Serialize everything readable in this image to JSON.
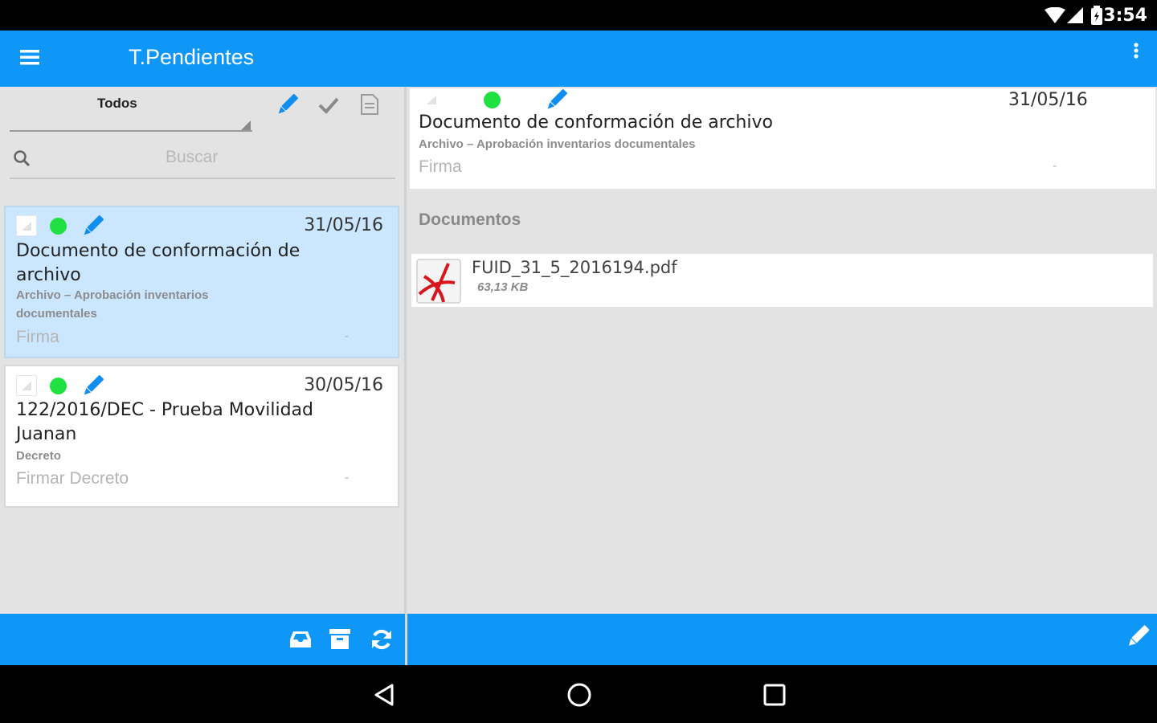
{
  "status_bar": {
    "time": "3:54",
    "icons": [
      "wifi-icon",
      "signal-icon",
      "battery-icon"
    ]
  },
  "app_bar": {
    "title": "T.Pendientes",
    "menu_icon": "hamburger-menu-icon",
    "overflow_icon": "overflow-menu-icon"
  },
  "filter": {
    "selected": "Todos",
    "actions": [
      "edit-icon",
      "check-icon",
      "document-icon"
    ]
  },
  "search": {
    "placeholder": "Buscar"
  },
  "tasks": [
    {
      "date": "31/05/16",
      "title": "Documento de conformación de archivo",
      "subtitle": "Archivo – Aprobación inventarios documentales",
      "action": "Firma",
      "dash": "-",
      "status_color": "#21e041",
      "selected": true
    },
    {
      "date": "30/05/16",
      "title": "122/2016/DEC - Prueba Movilidad Juanan",
      "subtitle": "Decreto",
      "action": "Firmar Decreto",
      "dash": "-",
      "status_color": "#21e041",
      "selected": false
    }
  ],
  "detail": {
    "date": "31/05/16",
    "title": "Documento de conformación de archivo",
    "subtitle": "Archivo – Aprobación inventarios documentales",
    "action": "Firma",
    "dash": "-"
  },
  "documents": {
    "heading": "Documentos",
    "files": [
      {
        "name": "FUID_31_5_2016194.pdf",
        "size": "63,13 KB",
        "icon": "pdf-file-icon"
      }
    ]
  },
  "bottom_bar": {
    "left_actions": [
      "inbox-icon",
      "archive-icon",
      "refresh-icon"
    ],
    "right_action": "edit-icon"
  },
  "nav_bar": {
    "buttons": [
      "back-icon",
      "home-icon",
      "recents-icon"
    ]
  },
  "colors": {
    "primary": "#0f97f8",
    "selected_bg": "#cbe6ff",
    "status_dot": "#21e041",
    "pencil": "#0f8ef0"
  }
}
